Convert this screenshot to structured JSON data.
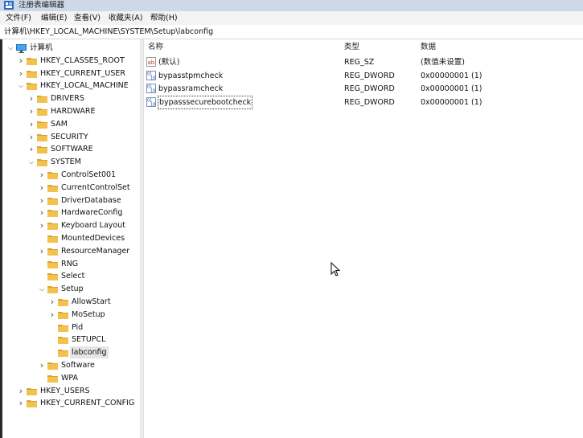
{
  "window": {
    "title": "注册表编辑器"
  },
  "menu": [
    "文件(F)",
    "编辑(E)",
    "查看(V)",
    "收藏夹(A)",
    "帮助(H)"
  ],
  "address": "计算机\\HKEY_LOCAL_MACHINE\\SYSTEM\\Setup\\labconfig",
  "tree": [
    {
      "label": "计算机",
      "state": "expanded",
      "icon": "computer-icon"
    },
    {
      "label": "HKEY_CLASSES_ROOT",
      "state": "collapsed"
    },
    {
      "label": "HKEY_CURRENT_USER",
      "state": "collapsed"
    },
    {
      "label": "HKEY_LOCAL_MACHINE",
      "state": "expanded"
    },
    {
      "label": "DRIVERS",
      "state": "collapsed"
    },
    {
      "label": "HARDWARE",
      "state": "collapsed"
    },
    {
      "label": "SAM",
      "state": "collapsed"
    },
    {
      "label": "SECURITY",
      "state": "collapsed"
    },
    {
      "label": "SOFTWARE",
      "state": "collapsed"
    },
    {
      "label": "SYSTEM",
      "state": "expanded"
    },
    {
      "label": "ControlSet001",
      "state": "collapsed"
    },
    {
      "label": "CurrentControlSet",
      "state": "collapsed"
    },
    {
      "label": "DriverDatabase",
      "state": "collapsed"
    },
    {
      "label": "HardwareConfig",
      "state": "collapsed"
    },
    {
      "label": "Keyboard Layout",
      "state": "collapsed"
    },
    {
      "label": "MountedDevices",
      "state": "leaf"
    },
    {
      "label": "ResourceManager",
      "state": "collapsed"
    },
    {
      "label": "RNG",
      "state": "leaf"
    },
    {
      "label": "Select",
      "state": "leaf"
    },
    {
      "label": "Setup",
      "state": "expanded"
    },
    {
      "label": "AllowStart",
      "state": "collapsed"
    },
    {
      "label": "MoSetup",
      "state": "collapsed"
    },
    {
      "label": "Pid",
      "state": "leaf"
    },
    {
      "label": "SETUPCL",
      "state": "leaf"
    },
    {
      "label": "labconfig",
      "state": "leaf",
      "selected": true
    },
    {
      "label": "Software",
      "state": "collapsed"
    },
    {
      "label": "WPA",
      "state": "leaf"
    },
    {
      "label": "HKEY_USERS",
      "state": "collapsed"
    },
    {
      "label": "HKEY_CURRENT_CONFIG",
      "state": "collapsed"
    }
  ],
  "columns": {
    "name": "名称",
    "type": "类型",
    "data": "数据"
  },
  "values": [
    {
      "name": "(默认)",
      "type": "REG_SZ",
      "data": "(数值未设置)",
      "icon": "string-value-icon"
    },
    {
      "name": "bypasstpmcheck",
      "type": "REG_DWORD",
      "data": "0x00000001 (1)",
      "icon": "binary-value-icon"
    },
    {
      "name": "bypassramcheck",
      "type": "REG_DWORD",
      "data": "0x00000001 (1)",
      "icon": "binary-value-icon"
    },
    {
      "name": "bypasssecurebootcheck",
      "type": "REG_DWORD",
      "data": "0x00000001 (1)",
      "icon": "binary-value-icon",
      "focused": true
    }
  ],
  "colors": {
    "folder": "#f2c14e",
    "folder_dark": "#d9a334",
    "titlebar": "#cdd9e8",
    "selection": "#e5e5e5"
  }
}
